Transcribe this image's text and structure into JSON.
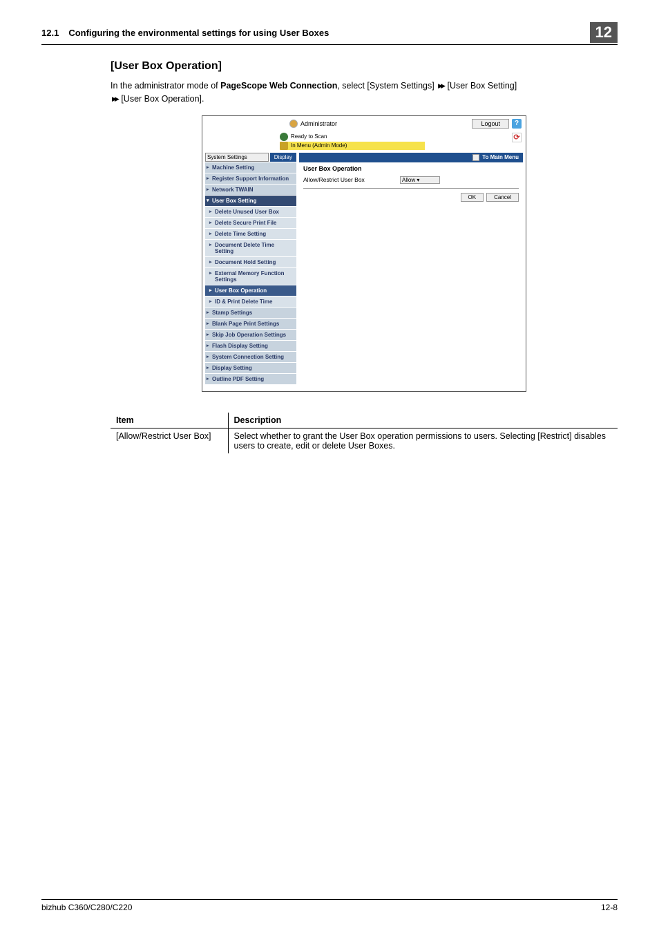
{
  "header": {
    "section_num": "12.1",
    "section_title": "Configuring the environmental settings for using User Boxes",
    "chapter_num": "12"
  },
  "section_heading": "[User Box Operation]",
  "intro_parts": {
    "p1": "In the administrator mode of ",
    "bold1": "PageScope Web Connection",
    "p2": ", select [System Settings] ",
    "p3": " [User Box Setting] ",
    "p4": " [User Box Operation]."
  },
  "screenshot": {
    "user_label": "Administrator",
    "logout": "Logout",
    "status1": "Ready to Scan",
    "status2": "In Menu (Admin Mode)",
    "select_value": "System Settings",
    "display_btn": "Display",
    "to_main_menu": "To Main Menu",
    "sidebar": {
      "items": [
        {
          "label": "Machine Setting",
          "type": "item"
        },
        {
          "label": "Register Support Information",
          "type": "item"
        },
        {
          "label": "Network TWAIN",
          "type": "item"
        },
        {
          "label": "User Box Setting",
          "type": "expanded"
        },
        {
          "label": "Delete Unused User Box",
          "type": "sub"
        },
        {
          "label": "Delete Secure Print File",
          "type": "sub"
        },
        {
          "label": "Delete Time Setting",
          "type": "sub"
        },
        {
          "label": "Document Delete Time Setting",
          "type": "sub"
        },
        {
          "label": "Document Hold Setting",
          "type": "sub"
        },
        {
          "label": "External Memory Function Settings",
          "type": "sub"
        },
        {
          "label": "User Box Operation",
          "type": "sub-active"
        },
        {
          "label": "ID & Print Delete Time",
          "type": "sub"
        },
        {
          "label": "Stamp Settings",
          "type": "item"
        },
        {
          "label": "Blank Page Print Settings",
          "type": "item"
        },
        {
          "label": "Skip Job Operation Settings",
          "type": "item"
        },
        {
          "label": "Flash Display Setting",
          "type": "item"
        },
        {
          "label": "System Connection Setting",
          "type": "item"
        },
        {
          "label": "Display Setting",
          "type": "item"
        },
        {
          "label": "Outline PDF Setting",
          "type": "item"
        }
      ]
    },
    "main": {
      "title": "User Box Operation",
      "row_label": "Allow/Restrict User Box",
      "row_value": "Allow",
      "ok": "OK",
      "cancel": "Cancel"
    }
  },
  "table": {
    "head_item": "Item",
    "head_desc": "Description",
    "row1_item": "[Allow/Restrict User Box]",
    "row1_desc": "Select whether to grant the User Box operation permissions to users. Selecting [Restrict] disables users to create, edit or delete User Boxes."
  },
  "footer": {
    "model": "bizhub C360/C280/C220",
    "page": "12-8"
  }
}
